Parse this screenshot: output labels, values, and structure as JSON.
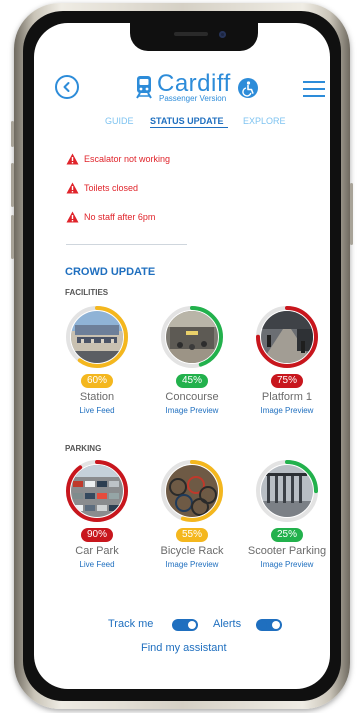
{
  "colors": {
    "accent": "#2d8cd9",
    "dark_accent": "#1f6fbf",
    "alert_red": "#e0242b",
    "green": "#22b14c",
    "yellow": "#f4b71e",
    "red": "#c8161d"
  },
  "header": {
    "title": "Cardiff",
    "subtitle": "Passenger Version",
    "back_icon": "back-arrow-icon",
    "train_icon": "train-icon",
    "access_icon": "wheelchair-icon",
    "menu_icon": "hamburger-menu-icon"
  },
  "tabs": [
    {
      "label": "GUIDE"
    },
    {
      "label": "STATUS UPDATE",
      "active": true
    },
    {
      "label": "EXPLORE"
    }
  ],
  "alerts": [
    {
      "text": "Escalator not working"
    },
    {
      "text": "Toilets closed"
    },
    {
      "text": "No staff after 6pm"
    }
  ],
  "crowd": {
    "title": "CROWD UPDATE",
    "facilities_label": "FACILITIES",
    "parking_label": "PARKING",
    "facilities": [
      {
        "name": "Station",
        "percent_label": "60%",
        "level": 0.6,
        "link": "Live Feed",
        "status": "yellow"
      },
      {
        "name": "Concourse",
        "percent_label": "45%",
        "level": 0.45,
        "link": "Image Preview",
        "status": "green"
      },
      {
        "name": "Platform 1",
        "percent_label": "75%",
        "level": 0.75,
        "link": "Image Preview",
        "status": "red"
      }
    ],
    "parking": [
      {
        "name": "Car Park",
        "percent_label": "90%",
        "level": 0.9,
        "link": "Live Feed",
        "status": "red"
      },
      {
        "name": "Bicycle Rack",
        "percent_label": "55%",
        "level": 0.55,
        "link": "Image Preview",
        "status": "yellow"
      },
      {
        "name": "Scooter Parking",
        "percent_label": "25%",
        "level": 0.25,
        "link": "Image Preview",
        "status": "green"
      }
    ]
  },
  "footer": {
    "track_label": "Track me",
    "alerts_label": "Alerts",
    "assistant_label": "Find my assistant"
  }
}
